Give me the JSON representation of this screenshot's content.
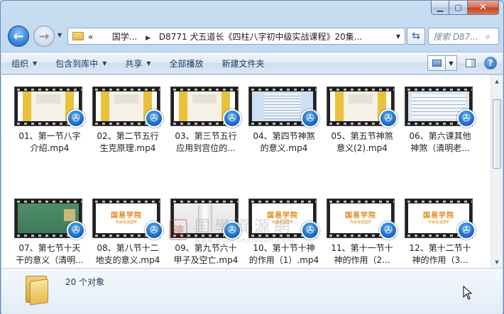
{
  "window": {
    "minimize_icon": "minimize-icon",
    "maximize_icon": "maximize-icon",
    "close_icon": "close-icon"
  },
  "nav": {
    "back_glyph": "←",
    "forward_glyph": "→",
    "address_prefix": "«",
    "address_parts": [
      "国学...",
      "D8771 犬五道长《四柱八字初中级实战课程》20集..."
    ],
    "address_sep": "▶",
    "search_placeholder": "搜索 D87..."
  },
  "toolbar": {
    "organize": "组织",
    "include_library": "包含到库中",
    "share": "共享",
    "play_all": "全部播放",
    "new_folder": "新建文件夹",
    "help": "?"
  },
  "files": [
    {
      "line1": "01、第一节八字",
      "line2": "介绍.mp4",
      "thumb": "stage"
    },
    {
      "line1": "02、第二节五行",
      "line2": "生克原理.mp4",
      "thumb": "stage"
    },
    {
      "line1": "03、第三节五行",
      "line2": "应用到宫位的...",
      "thumb": "stage"
    },
    {
      "line1": "04、第四节神煞",
      "line2": "的意义.mp4",
      "thumb": "doc"
    },
    {
      "line1": "05、第五节神煞",
      "line2": "意义(2).mp4",
      "thumb": "stage"
    },
    {
      "line1": "06、第六课其他",
      "line2": "神煞（清明老...",
      "thumb": "doc2"
    },
    {
      "line1": "07、第七节十天",
      "line2": "干的意义（清明...",
      "thumb": "green"
    },
    {
      "line1": "08、第八节十二",
      "line2": "地支的意义.mp4",
      "thumb": "academy"
    },
    {
      "line1": "09、第九节六十",
      "line2": "甲子及空亡.mp4",
      "thumb": "scroll"
    },
    {
      "line1": "10、第十节十神",
      "line2": "的作用（1）.mp4",
      "thumb": "academy"
    },
    {
      "line1": "11、第十一节十",
      "line2": "神的作用（2...",
      "thumb": "academy"
    },
    {
      "line1": "12、第十二节十",
      "line2": "神的作用（3...",
      "thumb": "academy"
    }
  ],
  "thumb_text": {
    "academy_title": "国易学院",
    "academy_sub": "传承易道国学"
  },
  "watermark": {
    "seal": "德",
    "chinese": "国學資源網",
    "url": "www.guoxueziyuan.com"
  },
  "status": {
    "count": "20 个对象"
  }
}
